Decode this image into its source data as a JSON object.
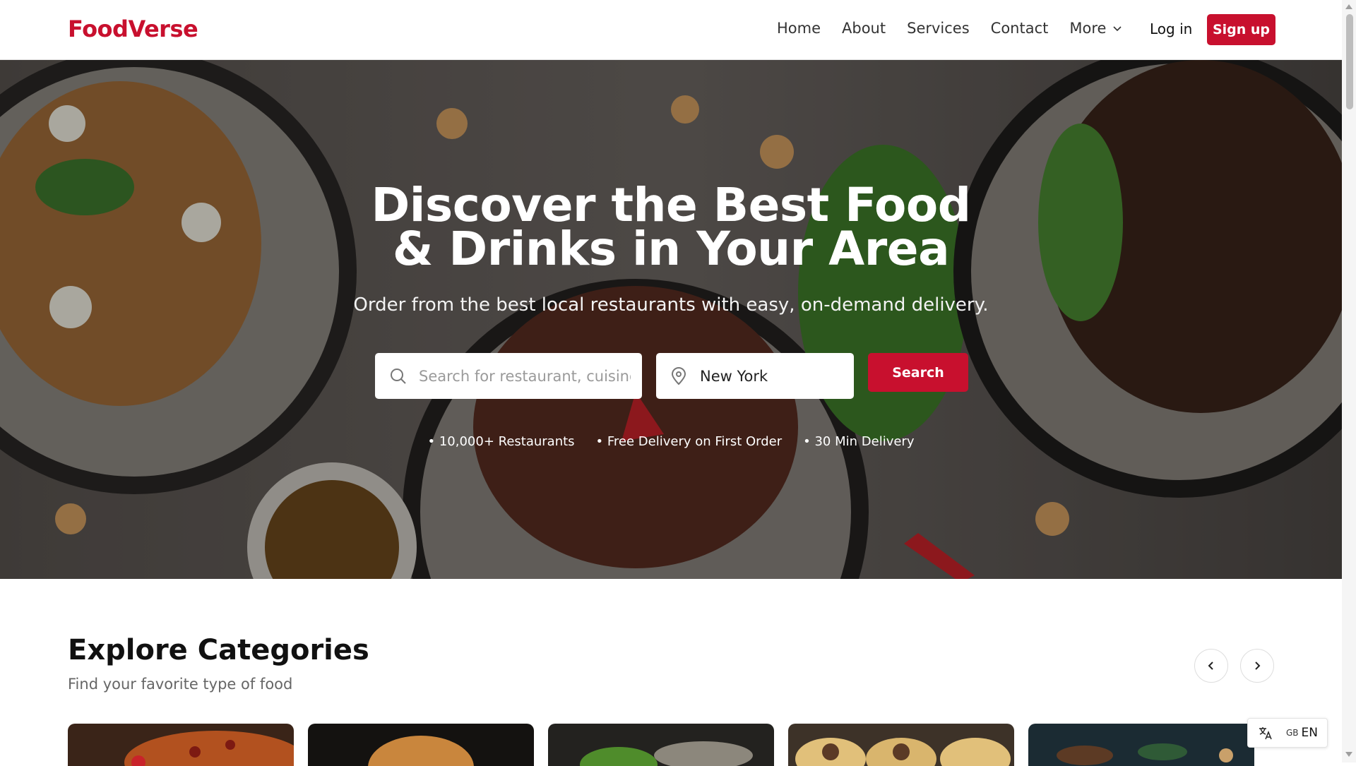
{
  "brand": {
    "name": "FoodVerse",
    "color": "#c8102e"
  },
  "nav": {
    "links": [
      "Home",
      "About",
      "Services",
      "Contact"
    ],
    "more_label": "More",
    "login_label": "Log in",
    "signup_label": "Sign up"
  },
  "hero": {
    "title_line1": "Discover the Best Food",
    "title_line2": "& Drinks in Your Area",
    "subtitle": "Order from the best local restaurants with easy, on-demand delivery.",
    "search_placeholder": "Search for restaurant, cuisine or a dish",
    "location_value": "New York",
    "search_button": "Search",
    "features": [
      "• 10,000+ Restaurants",
      "• Free Delivery on First Order",
      "• 30 Min Delivery"
    ]
  },
  "categories": {
    "title": "Explore Categories",
    "subtitle": "Find your favorite type of food",
    "cards": [
      "pizza-image",
      "burger-image",
      "salad-image",
      "tacos-image",
      "bowls-image"
    ]
  },
  "language": {
    "country": "GB",
    "code": "EN"
  },
  "colors": {
    "accent": "#c8102e",
    "hero_bg": "#4a4744"
  },
  "icons": [
    "search-icon",
    "location-pin-icon",
    "chevron-down-icon",
    "chevron-left-icon",
    "chevron-right-icon",
    "translate-icon"
  ]
}
